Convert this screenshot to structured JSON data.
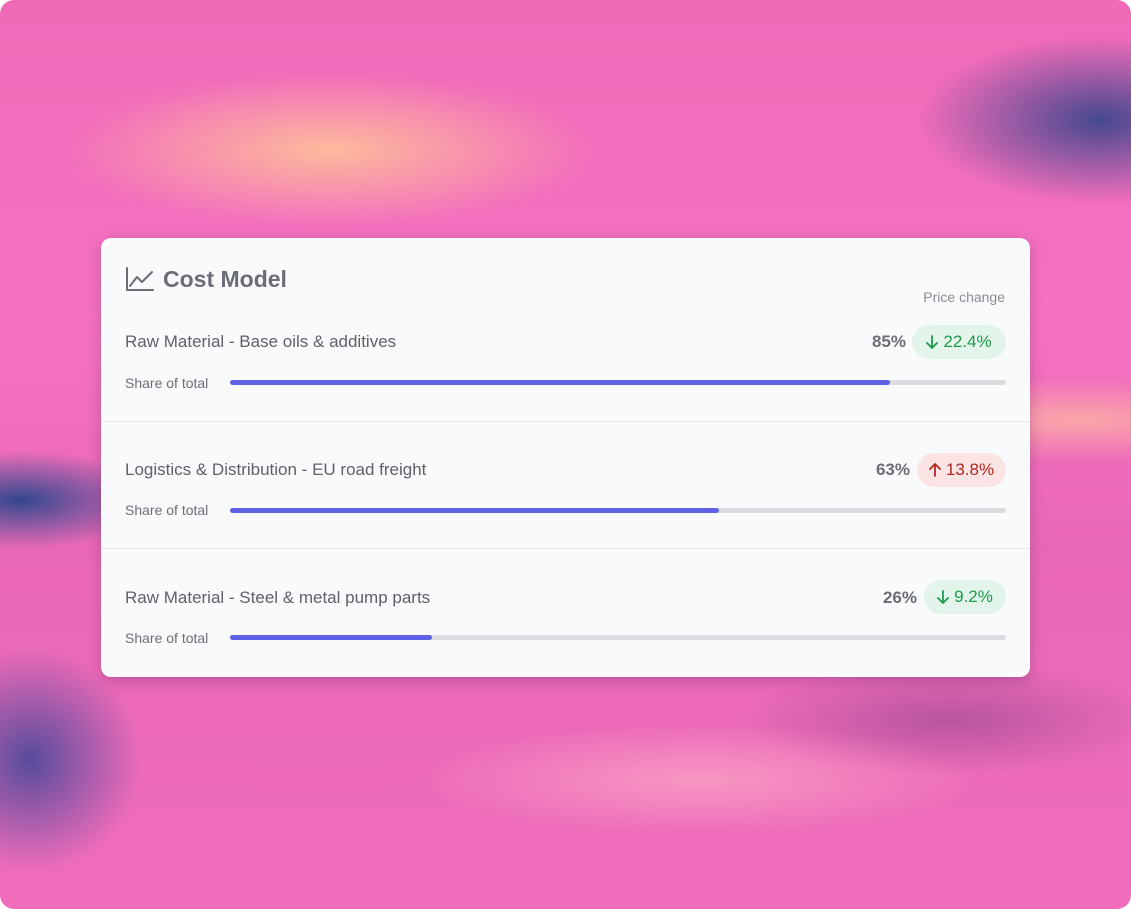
{
  "card": {
    "title": "Cost Model",
    "icon": "line-chart-icon",
    "price_change_label": "Price change"
  },
  "rows": [
    {
      "label": "Raw Material - Base oils & additives",
      "share_pct": "85%",
      "share_fraction": 0.85,
      "change": "22.4%",
      "direction": "down",
      "share_label": "Share of total"
    },
    {
      "label": "Logistics & Distribution - EU road freight",
      "share_pct": "63%",
      "share_fraction": 0.63,
      "change": "13.8%",
      "direction": "up",
      "share_label": "Share of total"
    },
    {
      "label": "Raw Material - Steel & metal pump parts",
      "share_pct": "26%",
      "share_fraction": 0.26,
      "change": "9.2%",
      "direction": "down",
      "share_label": "Share of total"
    }
  ],
  "colors": {
    "bar_fill": "#6163e6",
    "bar_track": "#dcdde0",
    "down_badge_bg": "#e3f5ea",
    "down_badge_text": "#1f9a4f",
    "up_badge_bg": "#fbe4e4",
    "up_badge_text": "#b3261e"
  }
}
